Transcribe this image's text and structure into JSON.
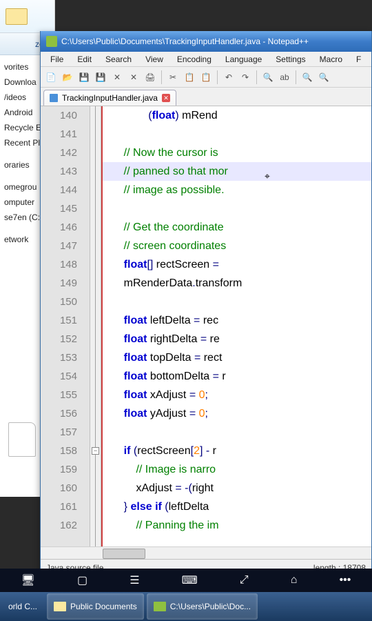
{
  "explorer": {
    "organize_suffix": "ze",
    "downarrow": "▾",
    "favorites": [
      "vorites",
      "Downloa",
      "/ideos",
      "Android",
      "Recycle E",
      "Recent Pl"
    ],
    "libraries": "oraries",
    "groups": [
      "omegrou",
      "omputer",
      "se7en (C:"
    ],
    "network": "etwork"
  },
  "npp": {
    "title": "C:\\Users\\Public\\Documents\\TrackingInputHandler.java - Notepad++",
    "menu": [
      "File",
      "Edit",
      "Search",
      "View",
      "Encoding",
      "Language",
      "Settings",
      "Macro",
      "F"
    ],
    "tab_name": "TrackingInputHandler.java",
    "status_left": "Java source file",
    "status_right": "length : 18708",
    "lines": {
      "start": 140,
      "end": 162,
      "fold_at": 158
    },
    "code": [
      {
        "n": 140,
        "t": "              <paren>(</paren><kw>float</kw><paren>)</paren> mRend"
      },
      {
        "n": 141,
        "t": ""
      },
      {
        "n": 142,
        "t": "      <cm>// Now the cursor is </cm>"
      },
      {
        "n": 143,
        "t": "      <cm>// panned so that mor</cm>",
        "hl": true
      },
      {
        "n": 144,
        "t": "      <cm>// image as possible.</cm>"
      },
      {
        "n": 145,
        "t": ""
      },
      {
        "n": 146,
        "t": "      <cm>// Get the coordinate</cm>"
      },
      {
        "n": 147,
        "t": "      <cm>// screen coordinates</cm>"
      },
      {
        "n": 148,
        "t": "      <kw>float</kw><op>[]</op> rectScreen <op>=</op> "
      },
      {
        "n": 149,
        "t": "      mRenderData<op>.</op>transform"
      },
      {
        "n": 150,
        "t": ""
      },
      {
        "n": 151,
        "t": "      <kw>float</kw> leftDelta <op>=</op> rec"
      },
      {
        "n": 152,
        "t": "      <kw>float</kw> rightDelta <op>=</op> re"
      },
      {
        "n": 153,
        "t": "      <kw>float</kw> topDelta <op>=</op> rect"
      },
      {
        "n": 154,
        "t": "      <kw>float</kw> bottomDelta <op>=</op> r"
      },
      {
        "n": 155,
        "t": "      <kw>float</kw> xAdjust <op>=</op> <nm>0</nm><op>;</op>"
      },
      {
        "n": 156,
        "t": "      <kw>float</kw> yAdjust <op>=</op> <nm>0</nm><op>;</op>"
      },
      {
        "n": 157,
        "t": ""
      },
      {
        "n": 158,
        "t": "      <kw>if</kw> <op>(</op>rectScreen<op>[</op><nm>2</nm><op>]</op> <op>-</op> r"
      },
      {
        "n": 159,
        "t": "          <cm>// Image is narro</cm>"
      },
      {
        "n": 160,
        "t": "          xAdjust <op>=</op> <op>-(</op>right"
      },
      {
        "n": 161,
        "t": "      <op>}</op> <kw>else</kw> <kw>if</kw> <op>(</op>leftDelta "
      },
      {
        "n": 162,
        "t": "          <cm>// Panning the im</cm>"
      }
    ]
  },
  "taskbar": {
    "left_label": "orld C...",
    "items": [
      {
        "label": "Public Documents"
      },
      {
        "label": "C:\\Users\\Public\\Doc..."
      }
    ]
  }
}
